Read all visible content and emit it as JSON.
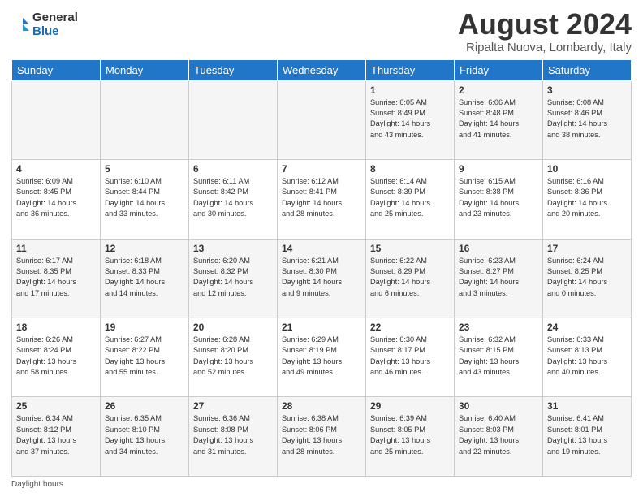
{
  "header": {
    "logo_general": "General",
    "logo_blue": "Blue",
    "month_title": "August 2024",
    "location": "Ripalta Nuova, Lombardy, Italy"
  },
  "days_of_week": [
    "Sunday",
    "Monday",
    "Tuesday",
    "Wednesday",
    "Thursday",
    "Friday",
    "Saturday"
  ],
  "footer": {
    "daylight_label": "Daylight hours"
  },
  "weeks": [
    [
      {
        "num": "",
        "info": ""
      },
      {
        "num": "",
        "info": ""
      },
      {
        "num": "",
        "info": ""
      },
      {
        "num": "",
        "info": ""
      },
      {
        "num": "1",
        "info": "Sunrise: 6:05 AM\nSunset: 8:49 PM\nDaylight: 14 hours\nand 43 minutes."
      },
      {
        "num": "2",
        "info": "Sunrise: 6:06 AM\nSunset: 8:48 PM\nDaylight: 14 hours\nand 41 minutes."
      },
      {
        "num": "3",
        "info": "Sunrise: 6:08 AM\nSunset: 8:46 PM\nDaylight: 14 hours\nand 38 minutes."
      }
    ],
    [
      {
        "num": "4",
        "info": "Sunrise: 6:09 AM\nSunset: 8:45 PM\nDaylight: 14 hours\nand 36 minutes."
      },
      {
        "num": "5",
        "info": "Sunrise: 6:10 AM\nSunset: 8:44 PM\nDaylight: 14 hours\nand 33 minutes."
      },
      {
        "num": "6",
        "info": "Sunrise: 6:11 AM\nSunset: 8:42 PM\nDaylight: 14 hours\nand 30 minutes."
      },
      {
        "num": "7",
        "info": "Sunrise: 6:12 AM\nSunset: 8:41 PM\nDaylight: 14 hours\nand 28 minutes."
      },
      {
        "num": "8",
        "info": "Sunrise: 6:14 AM\nSunset: 8:39 PM\nDaylight: 14 hours\nand 25 minutes."
      },
      {
        "num": "9",
        "info": "Sunrise: 6:15 AM\nSunset: 8:38 PM\nDaylight: 14 hours\nand 23 minutes."
      },
      {
        "num": "10",
        "info": "Sunrise: 6:16 AM\nSunset: 8:36 PM\nDaylight: 14 hours\nand 20 minutes."
      }
    ],
    [
      {
        "num": "11",
        "info": "Sunrise: 6:17 AM\nSunset: 8:35 PM\nDaylight: 14 hours\nand 17 minutes."
      },
      {
        "num": "12",
        "info": "Sunrise: 6:18 AM\nSunset: 8:33 PM\nDaylight: 14 hours\nand 14 minutes."
      },
      {
        "num": "13",
        "info": "Sunrise: 6:20 AM\nSunset: 8:32 PM\nDaylight: 14 hours\nand 12 minutes."
      },
      {
        "num": "14",
        "info": "Sunrise: 6:21 AM\nSunset: 8:30 PM\nDaylight: 14 hours\nand 9 minutes."
      },
      {
        "num": "15",
        "info": "Sunrise: 6:22 AM\nSunset: 8:29 PM\nDaylight: 14 hours\nand 6 minutes."
      },
      {
        "num": "16",
        "info": "Sunrise: 6:23 AM\nSunset: 8:27 PM\nDaylight: 14 hours\nand 3 minutes."
      },
      {
        "num": "17",
        "info": "Sunrise: 6:24 AM\nSunset: 8:25 PM\nDaylight: 14 hours\nand 0 minutes."
      }
    ],
    [
      {
        "num": "18",
        "info": "Sunrise: 6:26 AM\nSunset: 8:24 PM\nDaylight: 13 hours\nand 58 minutes."
      },
      {
        "num": "19",
        "info": "Sunrise: 6:27 AM\nSunset: 8:22 PM\nDaylight: 13 hours\nand 55 minutes."
      },
      {
        "num": "20",
        "info": "Sunrise: 6:28 AM\nSunset: 8:20 PM\nDaylight: 13 hours\nand 52 minutes."
      },
      {
        "num": "21",
        "info": "Sunrise: 6:29 AM\nSunset: 8:19 PM\nDaylight: 13 hours\nand 49 minutes."
      },
      {
        "num": "22",
        "info": "Sunrise: 6:30 AM\nSunset: 8:17 PM\nDaylight: 13 hours\nand 46 minutes."
      },
      {
        "num": "23",
        "info": "Sunrise: 6:32 AM\nSunset: 8:15 PM\nDaylight: 13 hours\nand 43 minutes."
      },
      {
        "num": "24",
        "info": "Sunrise: 6:33 AM\nSunset: 8:13 PM\nDaylight: 13 hours\nand 40 minutes."
      }
    ],
    [
      {
        "num": "25",
        "info": "Sunrise: 6:34 AM\nSunset: 8:12 PM\nDaylight: 13 hours\nand 37 minutes."
      },
      {
        "num": "26",
        "info": "Sunrise: 6:35 AM\nSunset: 8:10 PM\nDaylight: 13 hours\nand 34 minutes."
      },
      {
        "num": "27",
        "info": "Sunrise: 6:36 AM\nSunset: 8:08 PM\nDaylight: 13 hours\nand 31 minutes."
      },
      {
        "num": "28",
        "info": "Sunrise: 6:38 AM\nSunset: 8:06 PM\nDaylight: 13 hours\nand 28 minutes."
      },
      {
        "num": "29",
        "info": "Sunrise: 6:39 AM\nSunset: 8:05 PM\nDaylight: 13 hours\nand 25 minutes."
      },
      {
        "num": "30",
        "info": "Sunrise: 6:40 AM\nSunset: 8:03 PM\nDaylight: 13 hours\nand 22 minutes."
      },
      {
        "num": "31",
        "info": "Sunrise: 6:41 AM\nSunset: 8:01 PM\nDaylight: 13 hours\nand 19 minutes."
      }
    ]
  ]
}
